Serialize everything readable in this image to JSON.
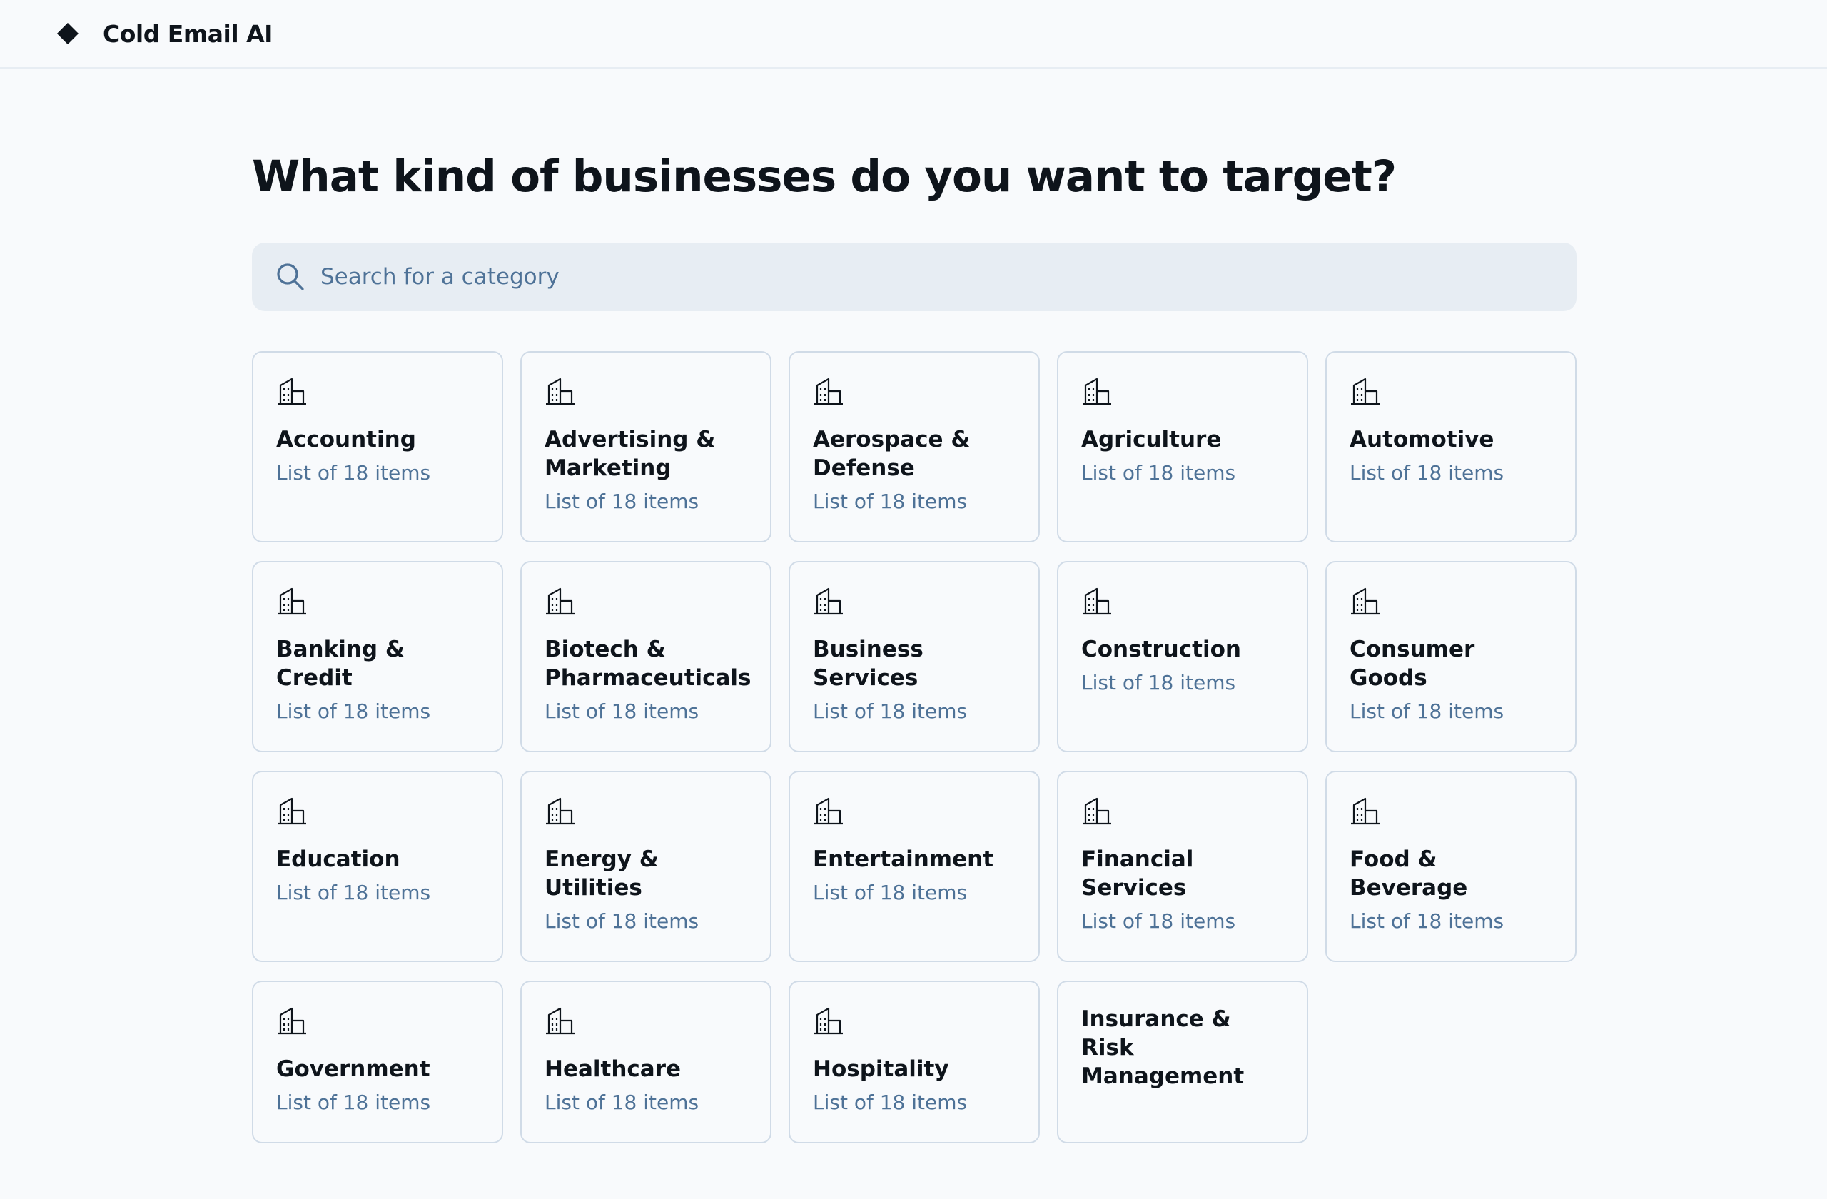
{
  "app": {
    "title": "Cold Email AI",
    "logo_icon": "diamond-logo-icon"
  },
  "page": {
    "heading": "What kind of businesses do you want to target?"
  },
  "search": {
    "placeholder": "Search for a category",
    "value": "",
    "icon": "search-icon"
  },
  "colors": {
    "accent_text": "#4e7297",
    "border": "#d0dbe7",
    "search_bg": "#e7edf3",
    "text": "#0e141b"
  },
  "categories": [
    {
      "name": "Accounting",
      "subtitle": "List of 18 items",
      "icon": "building-icon"
    },
    {
      "name": "Advertising & Marketing",
      "subtitle": "List of 18 items",
      "icon": "building-icon"
    },
    {
      "name": "Aerospace & Defense",
      "subtitle": "List of 18 items",
      "icon": "building-icon"
    },
    {
      "name": "Agriculture",
      "subtitle": "List of 18 items",
      "icon": "building-icon"
    },
    {
      "name": "Automotive",
      "subtitle": "List of 18 items",
      "icon": "building-icon"
    },
    {
      "name": "Banking & Credit",
      "subtitle": "List of 18 items",
      "icon": "building-icon"
    },
    {
      "name": "Biotech & Pharmaceuticals",
      "subtitle": "List of 18 items",
      "icon": "building-icon"
    },
    {
      "name": "Business Services",
      "subtitle": "List of 18 items",
      "icon": "building-icon"
    },
    {
      "name": "Construction",
      "subtitle": "List of 18 items",
      "icon": "building-icon"
    },
    {
      "name": "Consumer Goods",
      "subtitle": "List of 18 items",
      "icon": "building-icon"
    },
    {
      "name": "Education",
      "subtitle": "List of 18 items",
      "icon": "building-icon"
    },
    {
      "name": "Energy & Utilities",
      "subtitle": "List of 18 items",
      "icon": "building-icon"
    },
    {
      "name": "Entertainment",
      "subtitle": "List of 18 items",
      "icon": "building-icon"
    },
    {
      "name": "Financial Services",
      "subtitle": "List of 18 items",
      "icon": "building-icon"
    },
    {
      "name": "Food & Beverage",
      "subtitle": "List of 18 items",
      "icon": "building-icon"
    },
    {
      "name": "Government",
      "subtitle": "List of 18 items",
      "icon": "building-icon"
    },
    {
      "name": "Healthcare",
      "subtitle": "List of 18 items",
      "icon": "building-icon"
    },
    {
      "name": "Hospitality",
      "subtitle": "List of 18 items",
      "icon": "building-icon"
    },
    {
      "name": "Insurance & Risk Management"
    }
  ]
}
